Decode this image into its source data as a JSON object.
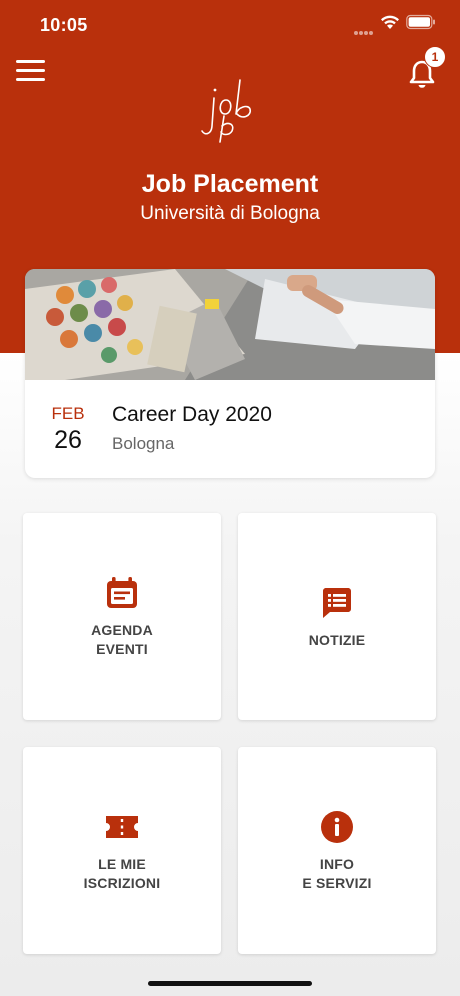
{
  "status_bar": {
    "time": "10:05"
  },
  "header": {
    "title": "Job Placement",
    "subtitle": "Università di Bologna",
    "notification_count": "1"
  },
  "event": {
    "month": "FEB",
    "day": "26",
    "title": "Career Day 2020",
    "location": "Bologna"
  },
  "tiles": [
    {
      "line1": "AGENDA",
      "line2": "EVENTI",
      "icon": "calendar-icon"
    },
    {
      "line1": "NOTIZIE",
      "line2": "",
      "icon": "news-icon"
    },
    {
      "line1": "LE MIE",
      "line2": "ISCRIZIONI",
      "icon": "ticket-icon"
    },
    {
      "line1": "INFO",
      "line2": "E SERVIZI",
      "icon": "info-icon"
    }
  ],
  "colors": {
    "brand": "#b9300c",
    "background": "#f1f1f1",
    "text": "#444444"
  }
}
